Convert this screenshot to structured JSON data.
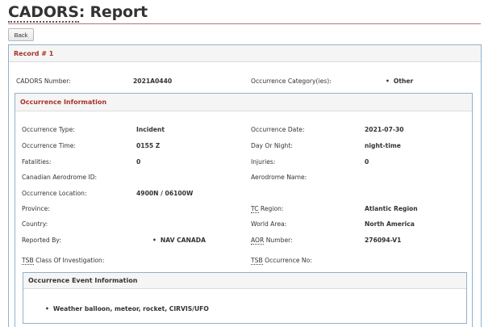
{
  "page": {
    "title_abbr": "CADORS",
    "title_rest": ": Report",
    "back_label": "Back"
  },
  "record": {
    "header": "Record # 1",
    "cadors_number_label": "CADORS Number:",
    "cadors_number": "2021A0440",
    "occurrence_category_label": "Occurrence Category(ies):",
    "occurrence_category": "Other"
  },
  "occurrence": {
    "header": "Occurrence Information",
    "fields": {
      "occurrence_type_label": "Occurrence Type:",
      "occurrence_type": "Incident",
      "occurrence_date_label": "Occurrence Date:",
      "occurrence_date": "2021-07-30",
      "occurrence_time_label": "Occurrence Time:",
      "occurrence_time": "0155 Z",
      "day_or_night_label": "Day Or Night:",
      "day_or_night": "night-time",
      "fatalities_label": "Fatalities:",
      "fatalities": "0",
      "injuries_label": "Injuries:",
      "injuries": "0",
      "aerodrome_id_label": "Canadian Aerodrome ID:",
      "aerodrome_name_label": "Aerodrome Name:",
      "location_label": "Occurrence Location:",
      "location": "4900N / 06100W",
      "province_label": "Province:",
      "tc_region_abbr": "TC",
      "tc_region_rest": " Region:",
      "tc_region": "Atlantic Region",
      "country_label": "Country:",
      "world_area_label": "World Area:",
      "world_area": "North America",
      "reported_by_label": "Reported By:",
      "reported_by": "NAV CANADA",
      "aor_abbr": "AOR",
      "aor_rest": " Number:",
      "aor_number": "276094-V1",
      "tsb_class_abbr": "TSB",
      "tsb_class_rest": " Class Of Investigation:",
      "tsb_occ_abbr": "TSB",
      "tsb_occ_rest": " Occurrence No:"
    }
  },
  "event_info": {
    "header": "Occurrence Event Information",
    "items": [
      "Weather balloon, meteor, rocket, CIRVIS/UFO"
    ]
  },
  "colors": {
    "section_title": "#a8322a",
    "panel_border": "#8fb2d0",
    "title_rule": "#b07a7a"
  }
}
